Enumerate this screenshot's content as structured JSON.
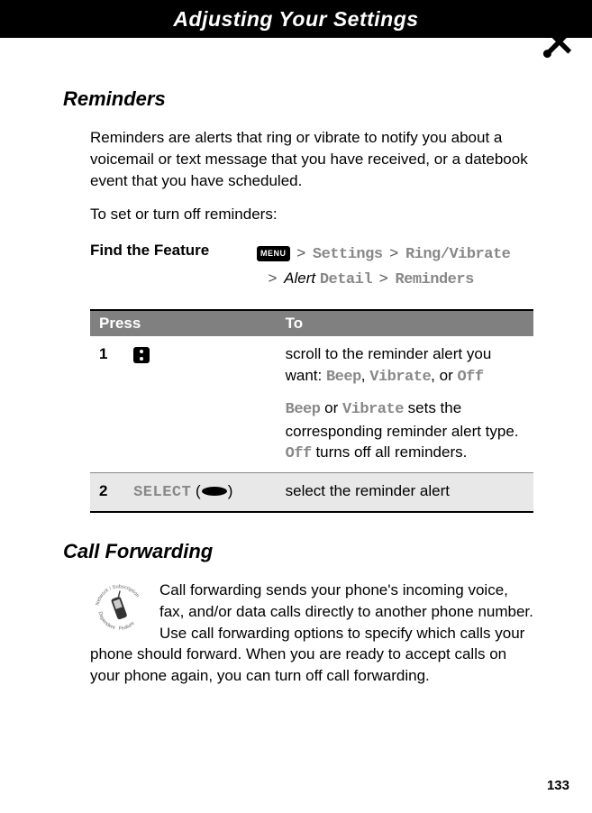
{
  "header": {
    "title": "Adjusting Your Settings"
  },
  "reminders": {
    "title": "Reminders",
    "intro": "Reminders are alerts that ring or vibrate to notify you about a voicemail or text message that you have received, or a datebook event that you have scheduled.",
    "instruction": "To set or turn off reminders:",
    "find_label": "Find the Feature",
    "menu_label": "MENU",
    "path": {
      "p1": "Settings",
      "p2": "Ring/Vibrate",
      "p3_italic": "Alert",
      "p3_mono": "Detail",
      "p4": "Reminders"
    },
    "table": {
      "col1": "Press",
      "col2": "To",
      "row1": {
        "num": "1",
        "desc_pre": "scroll to the reminder alert you want: ",
        "opt1": "Beep",
        "opt2": "Vibrate",
        "opt_or": ", or ",
        "opt3": "Off",
        "desc2_a": "Beep",
        "desc2_or": " or ",
        "desc2_b": "Vibrate",
        "desc2_mid": " sets the corresponding reminder alert type. ",
        "desc2_c": "Off",
        "desc2_end": " turns off all reminders."
      },
      "row2": {
        "num": "2",
        "button": "SELECT",
        "paren_open": " (",
        "paren_close": ")",
        "desc": "select the reminder alert"
      }
    }
  },
  "callfw": {
    "title": "Call Forwarding",
    "text": "Call forwarding sends your phone's incoming voice, fax, and/or data calls directly to another phone number. Use call forwarding options to specify which calls your phone should forward. When you are ready to accept calls on your phone again, you can turn off call forwarding."
  },
  "page_number": "133"
}
